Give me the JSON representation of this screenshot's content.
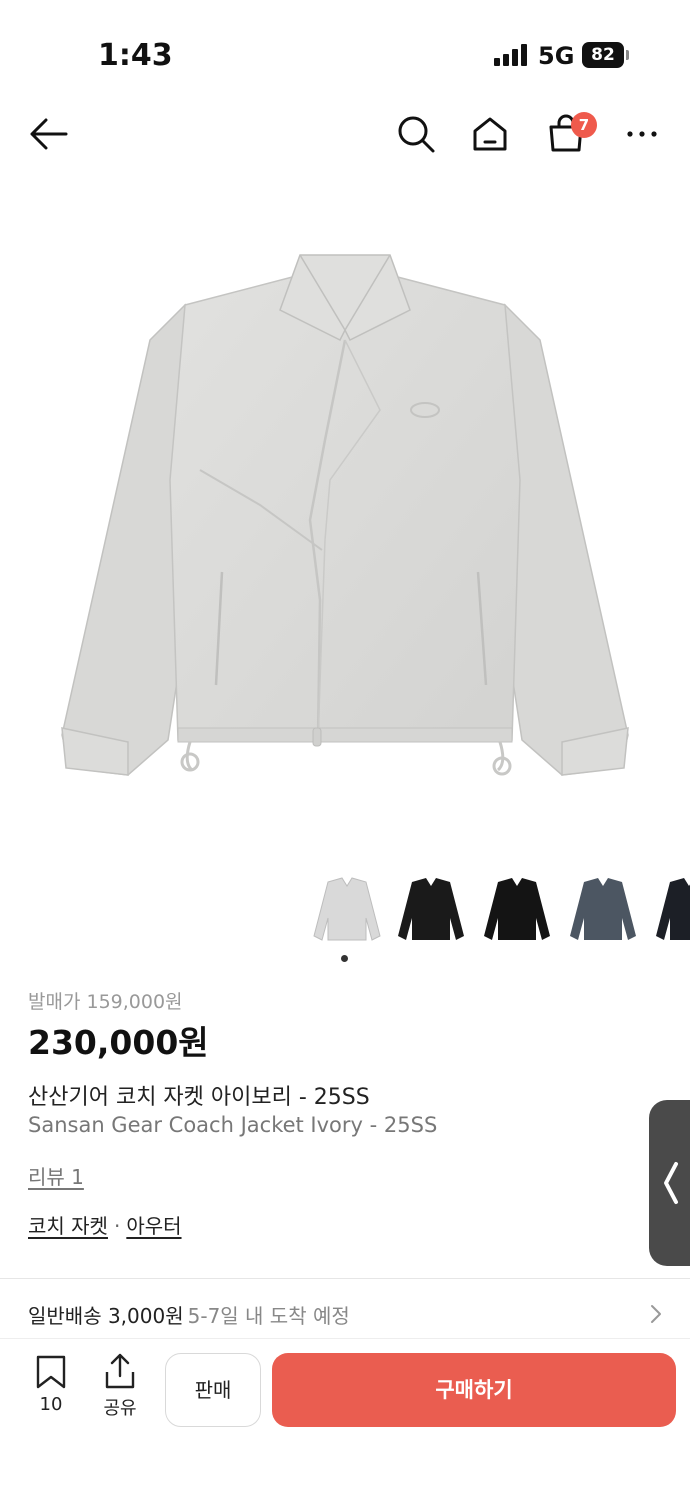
{
  "status_bar": {
    "time": "1:43",
    "network": "5G",
    "battery": "82"
  },
  "nav": {
    "cart_count": "7",
    "icons": [
      "back-arrow-icon",
      "search-icon",
      "home-icon",
      "cart-icon",
      "more-icon"
    ]
  },
  "gallery": {
    "thumbnail_colors": [
      "#d9d9d9",
      "#1a1a1a",
      "#141414",
      "#4c5662",
      "#1c1f26"
    ],
    "current_index": 1
  },
  "product": {
    "original_price": "발매가 159,000원",
    "price": "230,000원",
    "title_ko": "산산기어 코치 자켓 아이보리 - 25SS",
    "title_en": "Sansan Gear Coach Jacket Ivory - 25SS",
    "review_link": "리뷰 1",
    "categories": [
      "코치 자켓",
      "아우터"
    ],
    "category_separator": "·"
  },
  "shipping": {
    "label": "일반배송 3,000원",
    "detail": "5-7일 내 도착 예정"
  },
  "bottom_bar": {
    "bookmark_count": "10",
    "share_label": "공유",
    "sell_label": "판매",
    "buy_label": "구매하기",
    "buy_color": "#ea5d50"
  }
}
